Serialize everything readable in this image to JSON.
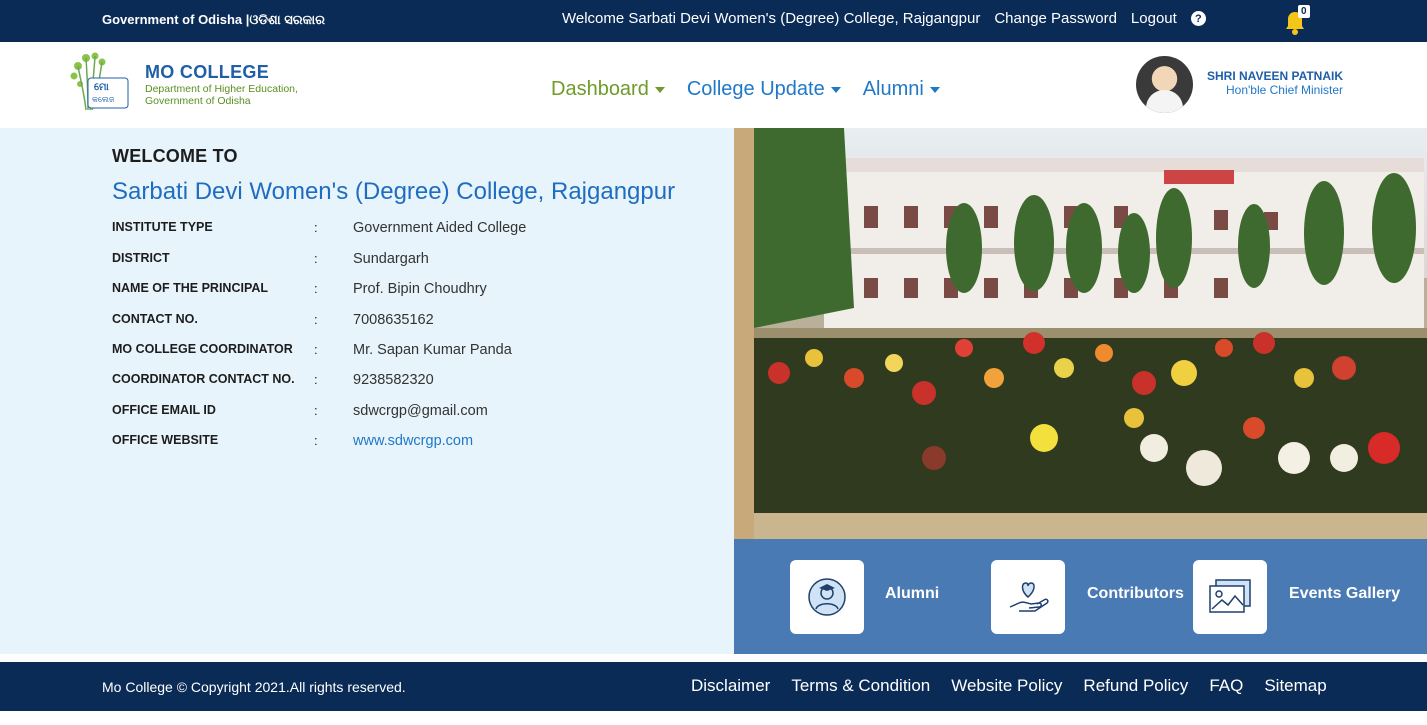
{
  "topbar": {
    "gov_label": "Government of Odisha |ଓଡିଶା ସରକାର",
    "welcome": "Welcome Sarbati Devi Women's (Degree) College, Rajgangpur",
    "change_password": "Change Password",
    "logout": "Logout",
    "help": "?",
    "notification_count": "0"
  },
  "header": {
    "brand_name": "MO COLLEGE",
    "brand_sub_1": "Department of Higher Education,",
    "brand_sub_2": "Government of Odisha",
    "nav": {
      "dashboard": "Dashboard",
      "college_update": "College Update",
      "alumni": "Alumni"
    },
    "cm_name": "SHRI NAVEEN PATNAIK",
    "cm_title": "Hon'ble Chief Minister"
  },
  "main": {
    "welcome": "WELCOME TO",
    "college_name": "Sarbati Devi Women's (Degree) College, Rajgangpur",
    "colon": ":",
    "info": [
      {
        "label": "INSTITUTE TYPE",
        "value": "Government Aided College"
      },
      {
        "label": "DISTRICT",
        "value": "Sundargarh"
      },
      {
        "label": "NAME OF THE PRINCIPAL",
        "value": "Prof. Bipin Choudhry"
      },
      {
        "label": "CONTACT NO.",
        "value": "7008635162"
      },
      {
        "label": "MO COLLEGE COORDINATOR",
        "value": "Mr. Sapan Kumar Panda"
      },
      {
        "label": "COORDINATOR CONTACT NO.",
        "value": "9238582320"
      },
      {
        "label": "OFFICE EMAIL ID",
        "value": "sdwcrgp@gmail.com"
      },
      {
        "label": "OFFICE WEBSITE",
        "value": "www.sdwcrgp.com"
      }
    ]
  },
  "quicklinks": {
    "alumni": "Alumni",
    "contributors": "Contributors",
    "events_gallery": "Events Gallery"
  },
  "footer": {
    "copyright": "Mo College © Copyright 2021.All rights reserved.",
    "links": [
      "Disclaimer",
      "Terms & Condition",
      "Website Policy",
      "Refund Policy",
      "FAQ",
      "Sitemap"
    ]
  },
  "colors": {
    "navy": "#0b2b57",
    "accent_blue": "#1f78c8",
    "accent_green": "#6f9b2a",
    "panel_bg": "#e8f4fb",
    "quicklink_bg": "#4a7ab3"
  }
}
